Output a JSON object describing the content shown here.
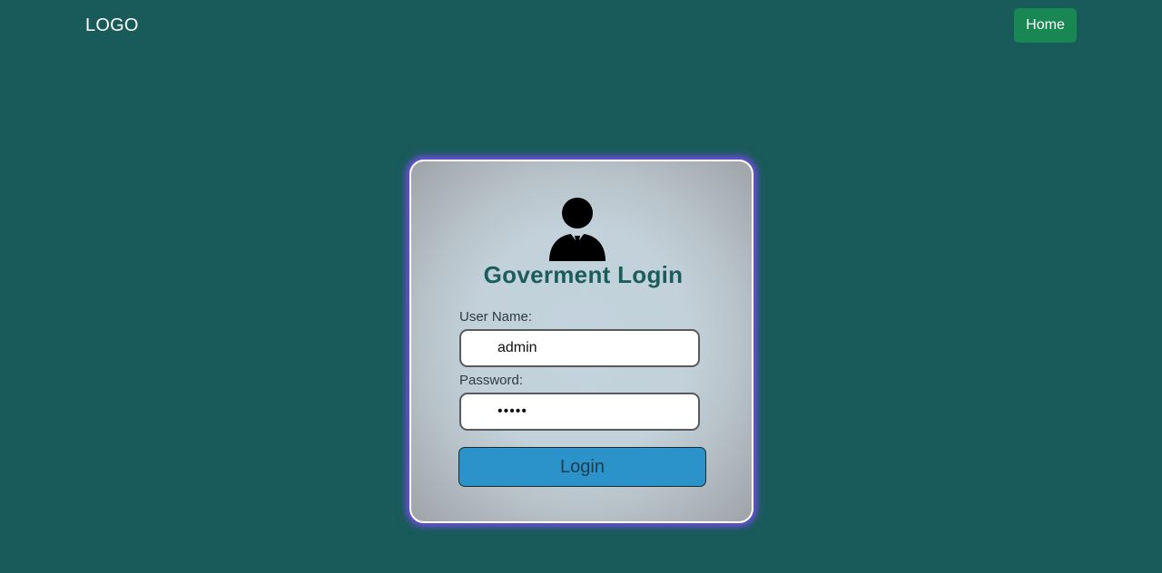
{
  "navbar": {
    "logo_text": "LOGO",
    "home_label": "Home"
  },
  "login_card": {
    "icon": "businessman-icon",
    "title": "Goverment Login",
    "username_label": "User Name:",
    "username_value": "admin",
    "password_label": "Password:",
    "password_value": "admin",
    "submit_label": "Login"
  },
  "colors": {
    "page_background": "#195b5a",
    "home_button": "#198754",
    "login_button": "#2b93c9",
    "title_text": "#1b5c5c",
    "card_glow": "#6b4fd8"
  }
}
